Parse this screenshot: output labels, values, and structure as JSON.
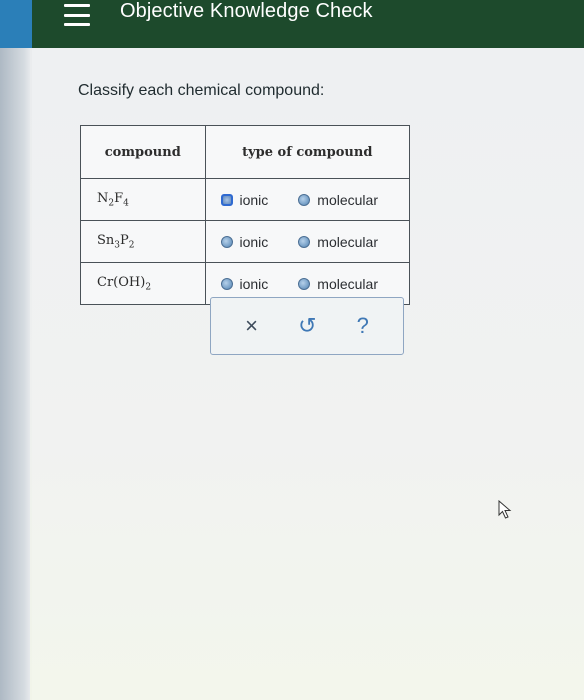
{
  "header": {
    "title": "Objective Knowledge Check"
  },
  "prompt": "Classify each chemical compound:",
  "table": {
    "headers": {
      "compound": "compound",
      "type": "type of compound"
    },
    "rows": [
      {
        "formula_parts": [
          "N",
          "2",
          "F",
          "4",
          "",
          ""
        ],
        "selected": "ionic"
      },
      {
        "formula_parts": [
          "Sn",
          "3",
          "P",
          "2",
          "",
          ""
        ],
        "selected": null
      },
      {
        "formula_parts": [
          "Cr",
          "",
          "(OH)",
          "2",
          "",
          ""
        ],
        "selected": null
      }
    ],
    "options": {
      "ionic": "ionic",
      "molecular": "molecular"
    }
  },
  "actions": {
    "clear": "×",
    "undo": "↺",
    "help": "?"
  },
  "colors": {
    "header_bg": "#1d4a2c",
    "accent_blue": "#3f78b5"
  }
}
